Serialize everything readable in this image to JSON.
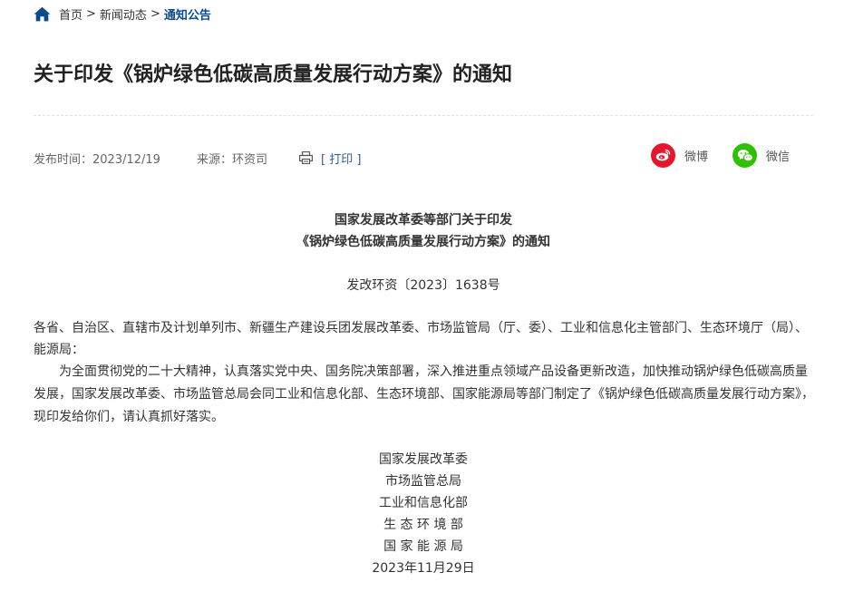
{
  "breadcrumb": {
    "home": "首页",
    "separator": ">",
    "section": "新闻动态",
    "current": "通知公告"
  },
  "article": {
    "title": "关于印发《锅炉绿色低碳高质量发展行动方案》的通知"
  },
  "meta": {
    "date": "发布时间：2023/12/19",
    "source": "来源：环资司",
    "print_label": "[ 打印 ]"
  },
  "share": {
    "weibo_label": "微博",
    "wechat_label": "微信"
  },
  "document": {
    "heading_line1": "国家发展改革委等部门关于印发",
    "heading_line2": "《锅炉绿色低碳高质量发展行动方案》的通知",
    "number": "发改环资〔2023〕1638号",
    "addressee": "各省、自治区、直辖市及计划单列市、新疆生产建设兵团发展改革委、市场监管局（厅、委）、工业和信息化主管部门、生态环境厅（局）、能源局：",
    "body": "为全面贯彻党的二十大精神，认真落实党中央、国务院决策部署，深入推进重点领域产品设备更新改造，加快推动锅炉绿色低碳高质量发展，国家发展改革委、市场监管总局会同工业和信息化部、生态环境部、国家能源局等部门制定了《锅炉绿色低碳高质量发展行动方案》，现印发给你们，请认真抓好落实。",
    "signatures": [
      "国家发展改革委",
      "市场监管总局",
      "工业和信息化部",
      "生 态 环 境 部",
      "国 家 能 源 局"
    ],
    "sign_date": "2023年11月29日"
  },
  "colors": {
    "breadcrumb_current": "#0c4a8c",
    "print_link": "#2a5c9a",
    "weibo": "#e6162d",
    "wechat": "#2dc100"
  },
  "icons": {
    "home": "home-icon",
    "print": "printer-icon",
    "weibo": "weibo-icon",
    "wechat": "wechat-icon"
  }
}
